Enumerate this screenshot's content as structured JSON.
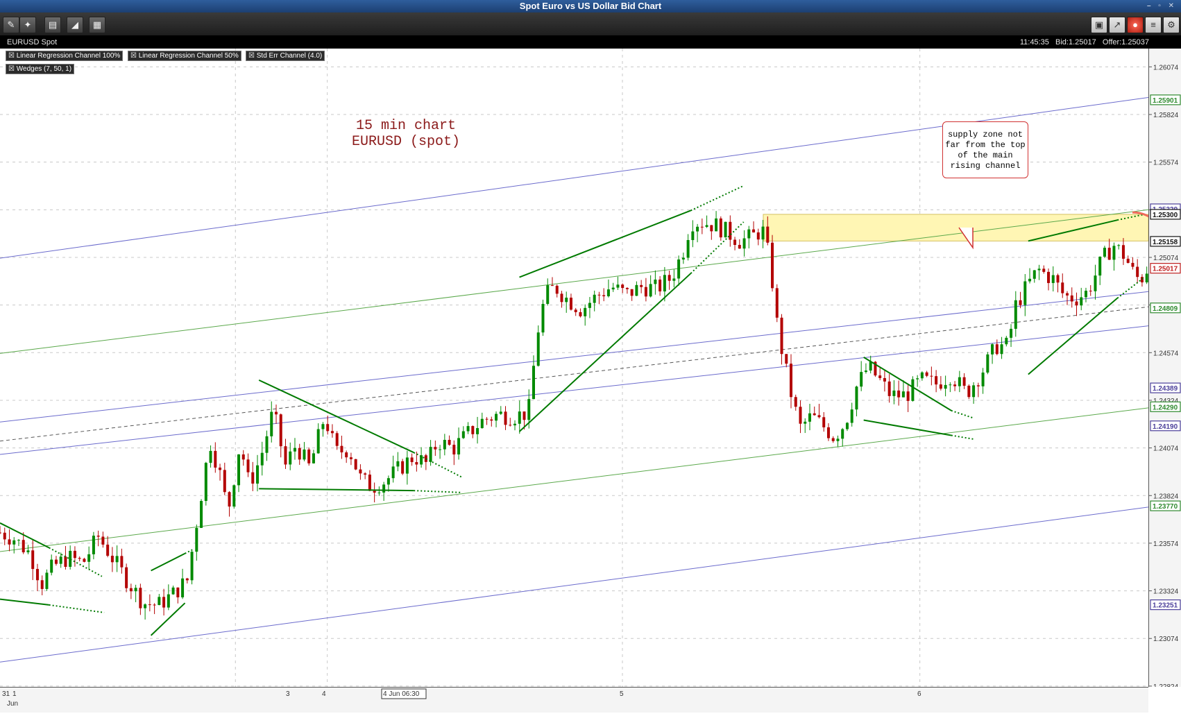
{
  "window": {
    "title": "Spot Euro vs US Dollar Bid Chart"
  },
  "toolbar": {
    "left_icons": [
      "pin-icon",
      "crosshair-icon",
      "print-icon",
      "draw-icon",
      "grid-icon"
    ],
    "right_icons": [
      "layout-icon",
      "chart-icon",
      "alert-icon",
      "notes-icon",
      "settings-icon"
    ]
  },
  "info": {
    "symbol": "EURUSD Spot",
    "time": "11:45:35",
    "bid": "Bid:1.25017",
    "offer": "Offer:1.25037"
  },
  "indicators": [
    "Linear Regression Channel 100%",
    "Linear Regression Channel 50%",
    "Std Err Channel (4.0)",
    "Wedges (7, 50, 1)"
  ],
  "annotation": {
    "line1": "15 min chart",
    "line2": "EURUSD  (spot)"
  },
  "callout": {
    "lines": [
      "supply zone not",
      "far from the top",
      "of the main",
      "rising channel"
    ]
  },
  "colors": {
    "up": "#008a00",
    "down": "#b30000",
    "wedge": "#007a00",
    "regression100": "#6a6acc",
    "regression50": "#5aa84a",
    "zone": "#fff6b4",
    "arrow": "#f06a5a"
  },
  "chart_data": {
    "type": "candlestick",
    "ylim": [
      1.2282,
      1.2617
    ],
    "y_ticks": [
      "1.26074",
      "1.25824",
      "1.25574",
      "1.25324",
      "1.25074",
      "1.24824",
      "1.24574",
      "1.24324",
      "1.24074",
      "1.23824",
      "1.23574",
      "1.23324",
      "1.23074",
      "1.22824"
    ],
    "price_markers": [
      {
        "value": "1.25901",
        "kind": "green"
      },
      {
        "value": "1.25329",
        "kind": "purple"
      },
      {
        "value": "1.25300",
        "kind": "black"
      },
      {
        "value": "1.25158",
        "kind": "black"
      },
      {
        "value": "1.25017",
        "kind": "red"
      },
      {
        "value": "1.24809",
        "kind": "green"
      },
      {
        "value": "1.24389",
        "kind": "purple"
      },
      {
        "value": "1.24290",
        "kind": "green"
      },
      {
        "value": "1.24190",
        "kind": "purple"
      },
      {
        "value": "1.23770",
        "kind": "green"
      },
      {
        "value": "1.23251",
        "kind": "purple"
      }
    ],
    "x_labels": [
      "31",
      "1",
      "Jun",
      "3",
      "4",
      "4 Jun 06:30",
      "5",
      "6"
    ],
    "supply_zone": {
      "from": 1.2516,
      "to": 1.253
    },
    "close_path": [
      [
        0,
        1.2363
      ],
      [
        18,
        1.236
      ],
      [
        40,
        1.2352
      ],
      [
        55,
        1.2336
      ],
      [
        70,
        1.2345
      ],
      [
        90,
        1.235
      ],
      [
        110,
        1.2347
      ],
      [
        130,
        1.2361
      ],
      [
        150,
        1.2349
      ],
      [
        170,
        1.2337
      ],
      [
        190,
        1.2326
      ],
      [
        210,
        1.2325
      ],
      [
        230,
        1.2331
      ],
      [
        248,
        1.2338
      ],
      [
        262,
        1.2372
      ],
      [
        278,
        1.2411
      ],
      [
        290,
        1.2396
      ],
      [
        302,
        1.2374
      ],
      [
        318,
        1.241
      ],
      [
        330,
        1.2388
      ],
      [
        345,
        1.2402
      ],
      [
        362,
        1.2427
      ],
      [
        378,
        1.2398
      ],
      [
        392,
        1.2409
      ],
      [
        410,
        1.2397
      ],
      [
        430,
        1.2424
      ],
      [
        445,
        1.2405
      ],
      [
        462,
        1.2407
      ],
      [
        478,
        1.2391
      ],
      [
        492,
        1.2387
      ],
      [
        510,
        1.239
      ],
      [
        530,
        1.2397
      ],
      [
        548,
        1.2403
      ],
      [
        565,
        1.2399
      ],
      [
        580,
        1.2411
      ],
      [
        600,
        1.2407
      ],
      [
        620,
        1.2415
      ],
      [
        640,
        1.2422
      ],
      [
        660,
        1.2425
      ],
      [
        680,
        1.2424
      ],
      [
        700,
        1.2426
      ],
      [
        712,
        1.2468
      ],
      [
        722,
        1.2487
      ],
      [
        735,
        1.2492
      ],
      [
        750,
        1.2486
      ],
      [
        770,
        1.248
      ],
      [
        790,
        1.2487
      ],
      [
        810,
        1.2492
      ],
      [
        830,
        1.2488
      ],
      [
        850,
        1.2492
      ],
      [
        870,
        1.2491
      ],
      [
        890,
        1.2497
      ],
      [
        905,
        1.2511
      ],
      [
        915,
        1.2526
      ],
      [
        930,
        1.2526
      ],
      [
        950,
        1.2524
      ],
      [
        965,
        1.252
      ],
      [
        980,
        1.2516
      ],
      [
        995,
        1.2518
      ],
      [
        1010,
        1.2522
      ],
      [
        1020,
        1.2505
      ],
      [
        1030,
        1.247
      ],
      [
        1040,
        1.245
      ],
      [
        1050,
        1.2432
      ],
      [
        1060,
        1.2418
      ],
      [
        1075,
        1.2424
      ],
      [
        1090,
        1.2419
      ],
      [
        1105,
        1.2413
      ],
      [
        1120,
        1.2421
      ],
      [
        1135,
        1.244
      ],
      [
        1150,
        1.245
      ],
      [
        1165,
        1.2443
      ],
      [
        1180,
        1.2435
      ],
      [
        1200,
        1.2435
      ],
      [
        1220,
        1.2443
      ],
      [
        1240,
        1.2441
      ],
      [
        1260,
        1.2446
      ],
      [
        1280,
        1.2436
      ],
      [
        1300,
        1.2447
      ],
      [
        1320,
        1.2461
      ],
      [
        1335,
        1.2461
      ],
      [
        1345,
        1.2482
      ],
      [
        1360,
        1.2492
      ],
      [
        1375,
        1.2501
      ],
      [
        1395,
        1.2496
      ],
      [
        1410,
        1.2487
      ],
      [
        1425,
        1.2486
      ],
      [
        1440,
        1.2489
      ],
      [
        1460,
        1.2506
      ],
      [
        1475,
        1.2514
      ],
      [
        1490,
        1.2508
      ],
      [
        1500,
        1.25
      ],
      [
        1510,
        1.2495
      ],
      [
        1520,
        1.2502
      ]
    ],
    "regression_lines": [
      {
        "style": "solid",
        "color": "regression100",
        "from": [
          0,
          1.2507
        ],
        "to": [
          1533,
          1.2592
        ]
      },
      {
        "style": "solid",
        "color": "regression100",
        "from": [
          0,
          1.2421
        ],
        "to": [
          1533,
          1.249
        ]
      },
      {
        "style": "solid",
        "color": "regression100",
        "from": [
          0,
          1.2404
        ],
        "to": [
          1533,
          1.2472
        ]
      },
      {
        "style": "solid",
        "color": "regression100",
        "from": [
          0,
          1.2295
        ],
        "to": [
          1533,
          1.2377
        ]
      },
      {
        "style": "dashed",
        "color": "midline",
        "from": [
          0,
          1.2411
        ],
        "to": [
          1533,
          1.2482
        ]
      },
      {
        "style": "solid",
        "color": "regression50",
        "from": [
          0,
          1.2457
        ],
        "to": [
          1533,
          1.2533
        ]
      },
      {
        "style": "solid",
        "color": "regression50",
        "from": [
          0,
          1.2353
        ],
        "to": [
          1533,
          1.2429
        ]
      }
    ],
    "wedges": [
      {
        "solid": [
          [
            0,
            1.2368
          ],
          [
            65,
            1.2355
          ]
        ],
        "dots": [
          [
            65,
            1.2355
          ],
          [
            135,
            1.234
          ]
        ]
      },
      {
        "solid": [
          [
            0,
            1.2328
          ],
          [
            65,
            1.2325
          ]
        ],
        "dots": [
          [
            65,
            1.2325
          ],
          [
            138,
            1.2321
          ]
        ]
      },
      {
        "solid": [
          [
            200,
            1.2309
          ],
          [
            245,
            1.2326
          ]
        ],
        "dots": []
      },
      {
        "solid": [
          [
            200,
            1.2343
          ],
          [
            245,
            1.2352
          ]
        ],
        "dots": [
          [
            245,
            1.2352
          ],
          [
            255,
            1.2354
          ]
        ]
      },
      {
        "solid": [
          [
            343,
            1.2443
          ],
          [
            548,
            1.2405
          ]
        ],
        "dots": [
          [
            548,
            1.2405
          ],
          [
            612,
            1.2392
          ]
        ]
      },
      {
        "solid": [
          [
            343,
            1.2386
          ],
          [
            548,
            1.2385
          ]
        ],
        "dots": [
          [
            548,
            1.2385
          ],
          [
            612,
            1.2384
          ]
        ]
      },
      {
        "solid": [
          [
            688,
            1.2497
          ],
          [
            915,
            1.2532
          ]
        ],
        "dots": [
          [
            915,
            1.2532
          ],
          [
            985,
            1.2545
          ]
        ]
      },
      {
        "solid": [
          [
            688,
            1.2416
          ],
          [
            915,
            1.2499
          ]
        ],
        "dots": [
          [
            915,
            1.2499
          ],
          [
            985,
            1.2526
          ]
        ]
      },
      {
        "solid": [
          [
            1144,
            1.2455
          ],
          [
            1260,
            1.2427
          ]
        ],
        "dots": [
          [
            1260,
            1.2427
          ],
          [
            1290,
            1.2423
          ]
        ]
      },
      {
        "solid": [
          [
            1144,
            1.2422
          ],
          [
            1260,
            1.2414
          ]
        ],
        "dots": [
          [
            1260,
            1.2414
          ],
          [
            1290,
            1.2412
          ]
        ]
      },
      {
        "solid": [
          [
            1362,
            1.2516
          ],
          [
            1480,
            1.2527
          ]
        ],
        "dots": [
          [
            1480,
            1.2527
          ],
          [
            1516,
            1.253
          ]
        ]
      },
      {
        "solid": [
          [
            1362,
            1.2446
          ],
          [
            1480,
            1.2486
          ]
        ],
        "dots": [
          [
            1480,
            1.2486
          ],
          [
            1516,
            1.2497
          ]
        ]
      }
    ],
    "projection_arrow": {
      "from": [
        1500,
        1.2531
      ],
      "peak": [
        1545,
        1.2528
      ],
      "to": [
        1604,
        1.2456
      ]
    }
  }
}
